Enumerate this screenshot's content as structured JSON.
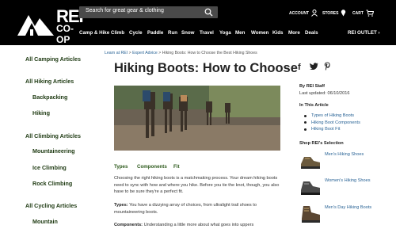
{
  "brand": {
    "name": "REI",
    "sub": "CO-OP"
  },
  "search": {
    "placeholder": "Search for great gear & clothing"
  },
  "header": {
    "account": "ACCOUNT",
    "stores": "STORES",
    "cart": "CART",
    "outlet": "REI OUTLET"
  },
  "nav": [
    "Camp & Hike",
    "Climb",
    "Cycle",
    "Paddle",
    "Run",
    "Snow",
    "Travel",
    "Yoga",
    "Men",
    "Women",
    "Kids",
    "More",
    "Deals"
  ],
  "sidebar": [
    {
      "label": "All Camping Articles"
    },
    {
      "label": "All Hiking Articles"
    },
    {
      "label": "Backpacking"
    },
    {
      "label": "Hiking"
    },
    {
      "label": "All Climbing Articles"
    },
    {
      "label": "Mountaineering"
    },
    {
      "label": "Ice Climbing"
    },
    {
      "label": "Rock Climbing"
    },
    {
      "label": "All Cycling Articles"
    },
    {
      "label": "Mountain"
    }
  ],
  "breadcrumb": {
    "crumbs": [
      "Learn at REI",
      "Expert Advice",
      "Hiking Boots: How to Choose the Best Hiking Shoes"
    ],
    "separator": ">"
  },
  "article": {
    "title": "Hiking Boots: How to Choose",
    "tabs": [
      "Types",
      "Components",
      "Fit"
    ],
    "intro": "Choosing the right hiking boots is a matchmaking process. Your dream hiking boots need to sync with how and where you hike. Before you tie the knot, though, you also have to be sure they're a perfect fit.",
    "types_label": "Types:",
    "types_text": "You have a dizzying array of choices, from ultralight trail shoes to mountaineering boots.",
    "components_label": "Components:",
    "components_text": "Understanding a little more about what goes into uppers"
  },
  "share": {
    "facebook": "f",
    "twitter": "🐦",
    "pinterest": "p"
  },
  "author": {
    "by": "By REI Staff",
    "updated": "Last updated: 06/10/2016"
  },
  "toc": {
    "heading": "In This Article",
    "items": [
      "Types of Hiking Boots",
      "Hiking Boot Components",
      "Hiking Boot Fit"
    ]
  },
  "shop": {
    "heading": "Shop REI's Selection",
    "products": [
      {
        "name": "Men's Hiking Shoes"
      },
      {
        "name": "Women's Hiking Shoes"
      },
      {
        "name": "Men's Day Hiking Boots"
      }
    ]
  }
}
